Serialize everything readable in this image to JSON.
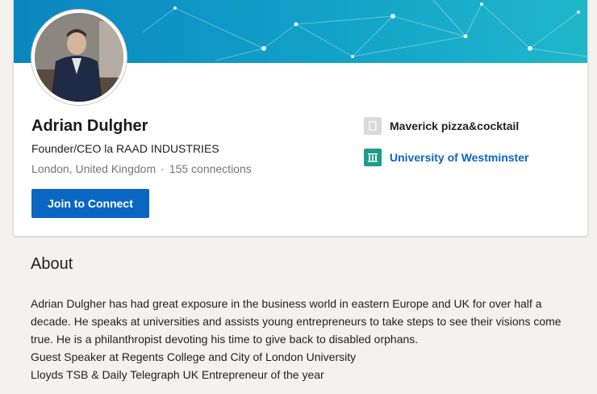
{
  "profile": {
    "name": "Adrian Dulgher",
    "headline": "Founder/CEO la RAAD INDUSTRIES",
    "location": "London, United Kingdom",
    "separator": "·",
    "connections": "155 connections",
    "join_label": "Join to Connect",
    "avatar_icon": "profile-photo",
    "banner_colors": [
      "#0a8fc4",
      "#19b3c8"
    ]
  },
  "experience": [
    {
      "label": "Maverick pizza&cocktail",
      "icon": "company-placeholder-icon"
    },
    {
      "label": "University of Westminster",
      "icon": "school-building-icon"
    }
  ],
  "about": {
    "title": "About",
    "lines": [
      "Adrian Dulgher has had great exposure in the business world in eastern Europe and UK for over half a decade. He speaks at universities and assists young entrepreneurs to take steps to see their visions come true. He is a philanthropist devoting his time to give back to disabled orphans.",
      "Guest Speaker at Regents College and City of London University",
      "Lloyds TSB & Daily Telegraph UK Entrepreneur of the year"
    ]
  }
}
